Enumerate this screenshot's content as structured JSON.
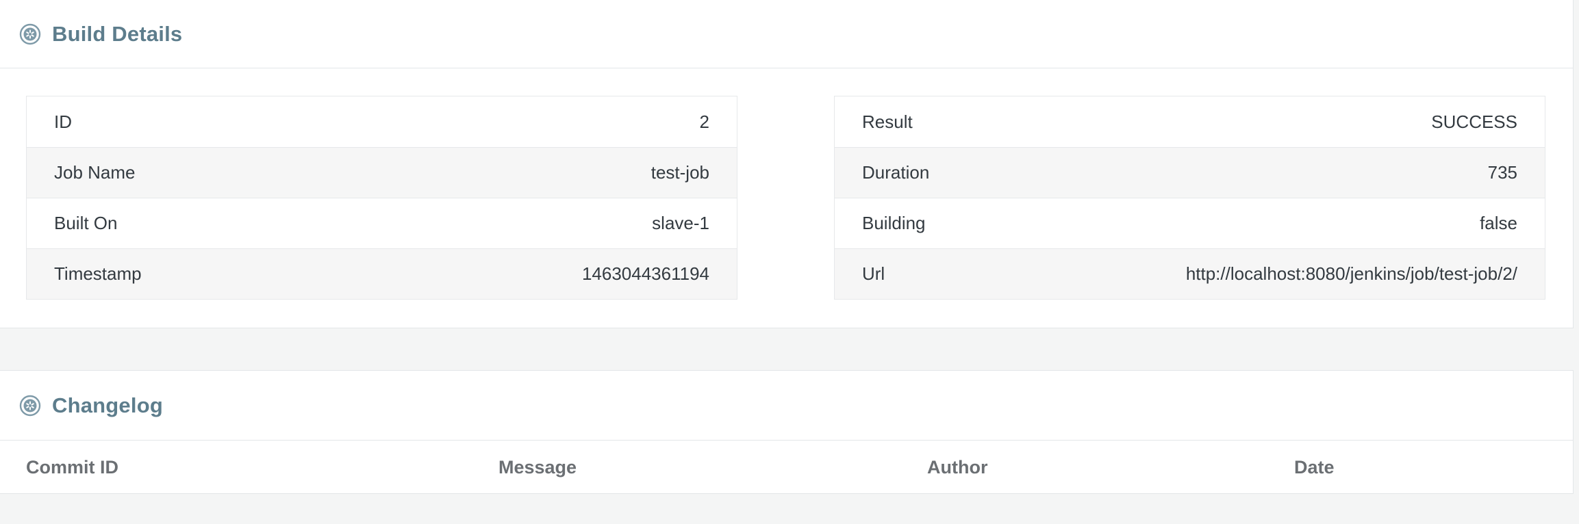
{
  "build_details": {
    "title": "Build Details",
    "icon": "settings-icon",
    "left_rows": [
      {
        "label": "ID",
        "value": "2"
      },
      {
        "label": "Job Name",
        "value": "test-job"
      },
      {
        "label": "Built On",
        "value": "slave-1"
      },
      {
        "label": "Timestamp",
        "value": "1463044361194"
      }
    ],
    "right_rows": [
      {
        "label": "Result",
        "value": "SUCCESS"
      },
      {
        "label": "Duration",
        "value": "735"
      },
      {
        "label": "Building",
        "value": "false"
      },
      {
        "label": "Url",
        "value": "http://localhost:8080/jenkins/job/test-job/2/"
      }
    ]
  },
  "changelog": {
    "title": "Changelog",
    "icon": "settings-icon",
    "columns": [
      "Commit ID",
      "Message",
      "Author",
      "Date"
    ]
  },
  "colors": {
    "title": "#5d7d8c",
    "background": "#f4f5f5",
    "row_alt": "#f6f6f6"
  }
}
